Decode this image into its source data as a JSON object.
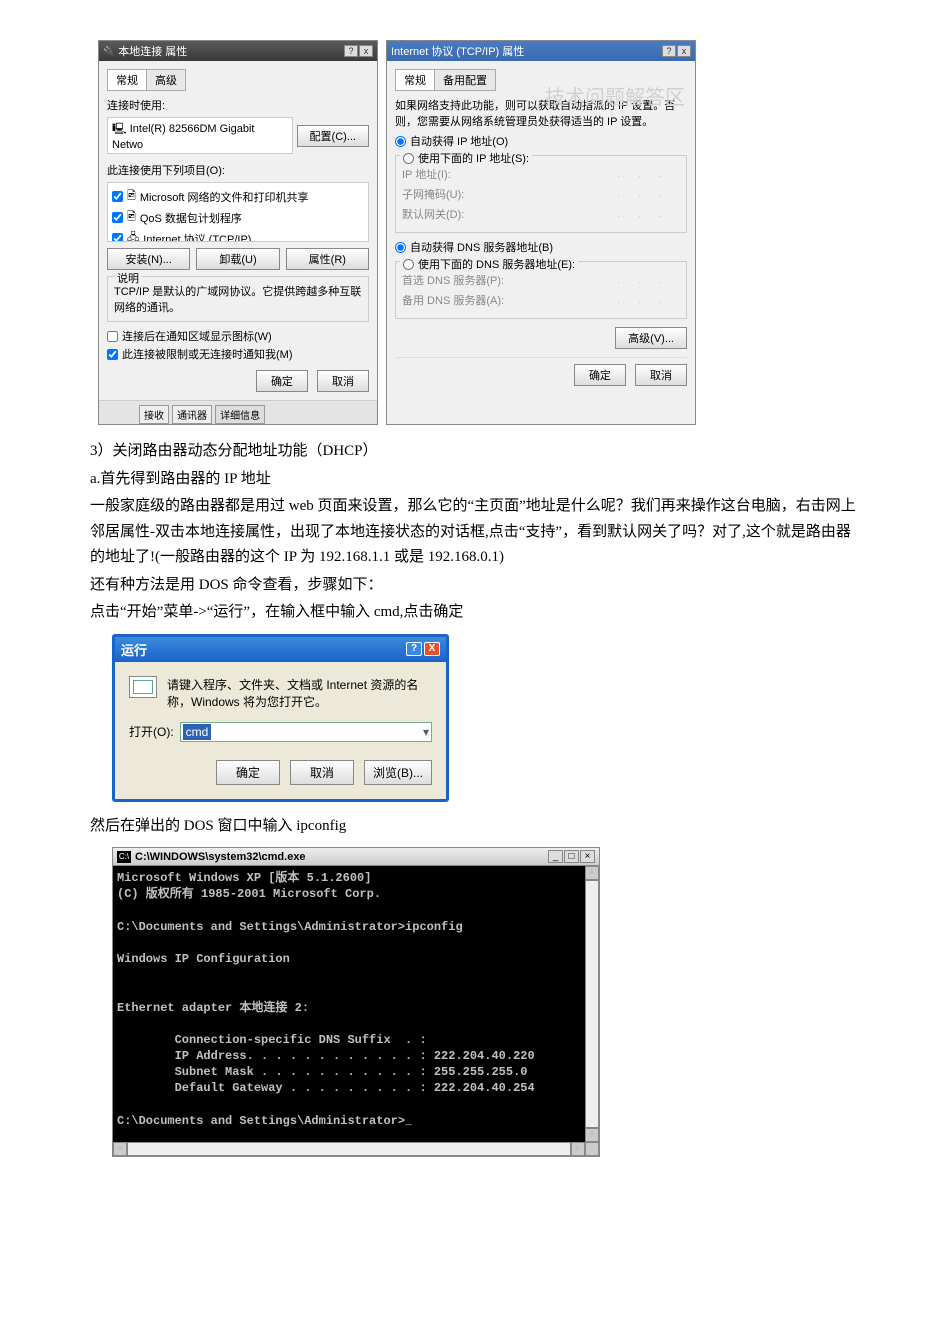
{
  "dlg1": {
    "title": "本地连接 属性",
    "help": "?",
    "close": "x",
    "tab1": "常规",
    "tab2": "高级",
    "connect_label": "连接时使用:",
    "adapter": "Intel(R) 82566DM Gigabit Netwo",
    "configure": "配置(C)...",
    "uses_label": "此连接使用下列项目(O):",
    "items": [
      "Microsoft 网络的文件和打印机共享",
      "QoS 数据包计划程序",
      "Internet 协议 (TCP/IP)"
    ],
    "install": "安装(N)...",
    "uninstall": "卸载(U)",
    "properties": "属性(R)",
    "desc_legend": "说明",
    "desc_text": "TCP/IP 是默认的广域网协议。它提供跨越多种互联网络的通讯。",
    "cb1": "连接后在通知区域显示图标(W)",
    "cb2": "此连接被限制或无连接时通知我(M)",
    "ok": "确定",
    "cancel": "取消",
    "tab_btm1": "接收",
    "tab_btm2": "通讯器",
    "detail": "详细信息"
  },
  "dlg2": {
    "title": "Internet 协议 (TCP/IP) 属性",
    "help": "?",
    "close": "x",
    "tab1": "常规",
    "tab2": "备用配置",
    "watermark": "技术问题解答区",
    "topnote": "如果网络支持此功能，则可以获取自动指派的 IP 设置。否则，您需要从网络系统管理员处获得适当的 IP 设置。",
    "auto_ip": "自动获得 IP 地址(O)",
    "manual_ip": "使用下面的 IP 地址(S):",
    "ip_lab": "IP 地址(I):",
    "mask_lab": "子网掩码(U):",
    "gw_lab": "默认网关(D):",
    "auto_dns": "自动获得 DNS 服务器地址(B)",
    "manual_dns": "使用下面的 DNS 服务器地址(E):",
    "pref_dns": "首选 DNS 服务器(P):",
    "alt_dns": "备用 DNS 服务器(A):",
    "advanced": "高级(V)...",
    "ok": "确定",
    "cancel": "取消"
  },
  "text": {
    "l1": "3）关闭路由器动态分配地址功能（DHCP）",
    "l2": "a.首先得到路由器的 IP 地址",
    "l3": "一般家庭级的路由器都是用过 web 页面来设置，那么它的“主页面”地址是什么呢？我们再来操作这台电脑，右击网上邻居属性-双击本地连接属性，出现了本地连接状态的对话框,点击“支持”，看到默认网关了吗？对了,这个就是路由器的地址了!(一般路由器的这个 IP 为 192.168.1.1 或是 192.168.0.1)",
    "l4": "还有种方法是用 DOS 命令查看，步骤如下：",
    "l5": "点击“开始”菜单->“运行”，在输入框中输入 cmd,点击确定",
    "l6": "然后在弹出的 DOS 窗口中输入 ipconfig"
  },
  "run": {
    "title": "运行",
    "help": "?",
    "close": "X",
    "desc": "请键入程序、文件夹、文档或 Internet 资源的名称，Windows 将为您打开它。",
    "open_label": "打开(O):",
    "value": "cmd",
    "ok": "确定",
    "cancel": "取消",
    "browse": "浏览(B)..."
  },
  "cmd": {
    "title": "C:\\WINDOWS\\system32\\cmd.exe",
    "min": "_",
    "max": "□",
    "close": "×",
    "lines": "Microsoft Windows XP [版本 5.1.2600]\n(C) 版权所有 1985-2001 Microsoft Corp.\n\nC:\\Documents and Settings\\Administrator>ipconfig\n\nWindows IP Configuration\n\n\nEthernet adapter 本地连接 2:\n\n        Connection-specific DNS Suffix  . :\n        IP Address. . . . . . . . . . . . : 222.204.40.220\n        Subnet Mask . . . . . . . . . . . : 255.255.255.0\n        Default Gateway . . . . . . . . . : 222.204.40.254\n\nC:\\Documents and Settings\\Administrator>_"
  }
}
